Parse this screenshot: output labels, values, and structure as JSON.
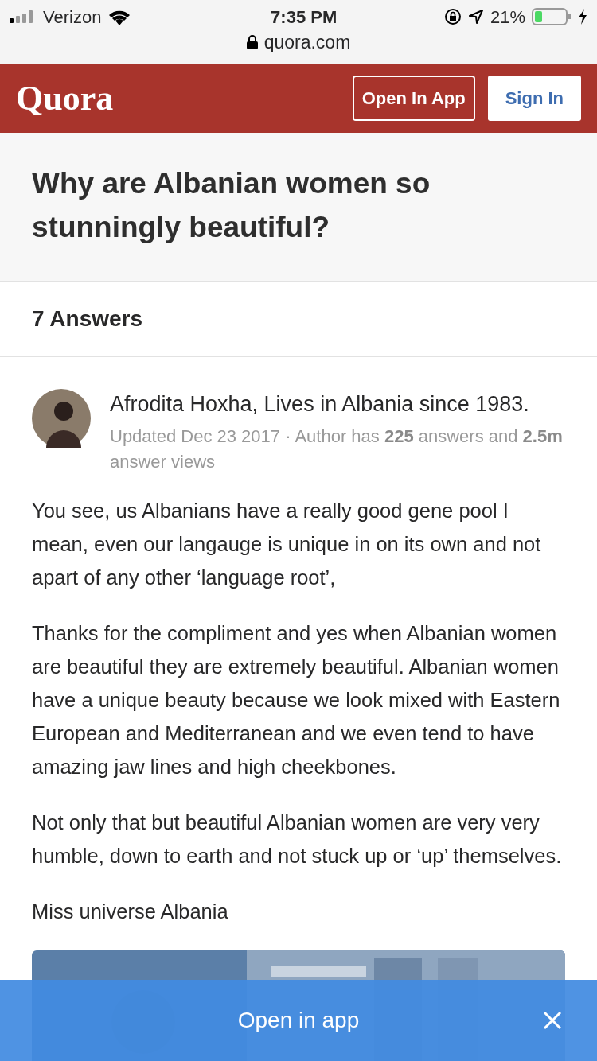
{
  "status_bar": {
    "carrier": "Verizon",
    "time": "7:35 PM",
    "url": "quora.com",
    "battery": "21%"
  },
  "header": {
    "logo": "Quora",
    "buttons": [
      {
        "label": "Open In App",
        "kind": "outline"
      },
      {
        "label": "Sign In",
        "kind": "solid"
      }
    ]
  },
  "question": {
    "title": "Why are Albanian women so stunningly beautiful?"
  },
  "answers_count": "7 Answers",
  "answer": {
    "author": "Afrodita Hoxha, Lives in Albania since 1983.",
    "meta": "Updated Dec 23 2017 · Author has **225** answers and **2.5m** answer views",
    "paragraphs": [
      "You see, us Albanians have a really good gene pool I mean, even our langauge is unique in on its own and not apart of any other ‘language root’,",
      "Thanks for the compliment and yes when Albanian women are beautiful they are extremely beautiful. Albanian women have a unique beauty because we look mixed with Eastern European and Mediterranean and we even tend to have amazing jaw lines and high cheekbones.",
      "Not only that but beautiful Albanian women are very very humble, down to earth and not stuck up or ‘up’ themselves.",
      "Miss universe Albania"
    ]
  },
  "app_banner": {
    "label": "Open in app"
  }
}
